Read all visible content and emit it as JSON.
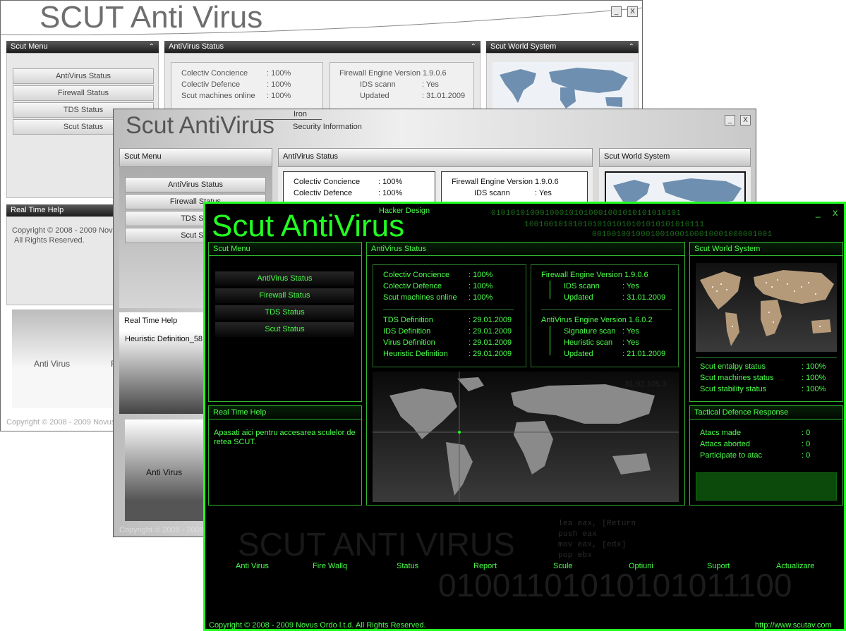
{
  "window1": {
    "title": "SCUT Anti Virus",
    "menu_header": "Scut Menu",
    "status_header": "AntiVirus Status",
    "world_header": "Scut World System",
    "menu_buttons": [
      "AntiVirus Status",
      "Firewall Status",
      "TDS Status",
      "Scut Status"
    ],
    "status_rows": [
      {
        "label": "Colectiv Concience",
        "value": ": 100%"
      },
      {
        "label": "Colectiv Defence",
        "value": ": 100%"
      },
      {
        "label": "Scut machines online",
        "value": ": 100%"
      }
    ],
    "firewall_title": "Firewall Engine Version 1.9.0.6",
    "firewall_rows": [
      {
        "label": "IDS scann",
        "value": ": Yes"
      },
      {
        "label": "Updated",
        "value": ": 31.01.2009"
      }
    ],
    "help_header": "Real Time Help",
    "copyright": "Copyright © 2008 - 2009 Novus",
    "rights": "All Rights Reserved.",
    "bottom_label": "Anti Virus",
    "bottom_label2": "F",
    "footer": "Copyright © 2008 - 2009 Novus",
    "minimize": "_",
    "close": "X"
  },
  "window2": {
    "title": "Scut AntiVirus",
    "theme_name": "Iron",
    "subtitle": "Security Information",
    "menu_header": "Scut Menu",
    "status_header": "AntiVirus Status",
    "world_header": "Scut World System",
    "menu_buttons": [
      "AntiVirus Status",
      "Firewall Status",
      "TDS Sta",
      "Scut Sta"
    ],
    "status_rows": [
      {
        "label": "Colectiv Concience",
        "value": ": 100%"
      },
      {
        "label": "Colectiv Defence",
        "value": ": 100%"
      }
    ],
    "firewall_title": "Firewall Engine Version 1.9.0.6",
    "firewall_rows": [
      {
        "label": "IDS scann",
        "value": ": Yes"
      }
    ],
    "help_header": "Real Time Help",
    "help_text": "Heuristic Definition_58",
    "bottom_label": "Anti Virus",
    "footer": "Copyright © 2008 - 2009",
    "minimize": "_",
    "close": "X"
  },
  "window3": {
    "title": "Scut AntiVirus",
    "theme_name": "Hacker Design",
    "binary_lines": [
      "010101010001000101010001001010101010101",
      "1001001010101010101010101010101010111",
      "0010010010001001000100010001000001001"
    ],
    "menu_header": "Scut Menu",
    "menu_buttons": [
      "AntiVirus Status",
      "Firewall Status",
      "TDS Status",
      "Scut Status"
    ],
    "status_header": "AntiVirus Status",
    "status_rows": [
      {
        "label": "Colectiv Concience",
        "value": ": 100%"
      },
      {
        "label": "Colectiv Defence",
        "value": ": 100%"
      },
      {
        "label": "Scut machines online",
        "value": ": 100%"
      }
    ],
    "definition_rows": [
      {
        "label": "TDS Definition",
        "value": ": 29.01.2009"
      },
      {
        "label": "IDS Definition",
        "value": ": 29.01.2009"
      },
      {
        "label": "Virus Definition",
        "value": ": 29.01.2009"
      },
      {
        "label": "Heuristic Definition",
        "value": ": 29.01.2009"
      }
    ],
    "firewall_title": "Firewall Engine Version 1.9.0.6",
    "firewall_rows": [
      {
        "label": "IDS scann",
        "value": ": Yes"
      },
      {
        "label": "Updated",
        "value": ": 31.01.2009"
      }
    ],
    "antivirus_title": "AntiVirus Engine Version 1.6.0.2",
    "antivirus_rows": [
      {
        "label": "Signature scan",
        "value": ": Yes"
      },
      {
        "label": "Heuristic scan",
        "value": ": Yes"
      },
      {
        "label": "Updated",
        "value": ": 21.01.2009"
      }
    ],
    "ip_address": "81.92.105.3",
    "world_header": "Scut World System",
    "world_rows": [
      {
        "label": "Scut entalpy status",
        "value": ": 100%"
      },
      {
        "label": "Scut machines status",
        "value": ": 100%"
      },
      {
        "label": "Scut stability status",
        "value": ": 100%"
      }
    ],
    "help_header": "Real Time Help",
    "help_text": "Apasati aici pentru accesarea sculelor de retea SCUT.",
    "tactical_header": "Tactical Defence Response",
    "tactical_rows": [
      {
        "label": "Atacs made",
        "value": ": 0"
      },
      {
        "label": "Attacs aborted",
        "value": ": 0"
      },
      {
        "label": "Participate to atac",
        "value": ": 0"
      }
    ],
    "watermark": "SCUT ANTI VIRUS",
    "asm_lines": [
      "lea    eax, [Return",
      "push   eax",
      "mov    eax, [edx]",
      "pop    ebx"
    ],
    "binary_bottom": "01001101010101011100",
    "nav": [
      "Anti Virus",
      "Fire Wallq",
      "Status",
      "Report",
      "Scule",
      "Optiuni",
      "Suport",
      "Actualizare"
    ],
    "copyright": "Copyright © 2008 - 2009 Novus Ordo l.t.d.  All Rights Reserved.",
    "url": "http://www.scutav.com",
    "minimize": "_",
    "close": "X"
  },
  "colors": {
    "green_accent": "#22ff22",
    "green_text": "#49ff49",
    "dark_header": "#1c1c1c"
  }
}
